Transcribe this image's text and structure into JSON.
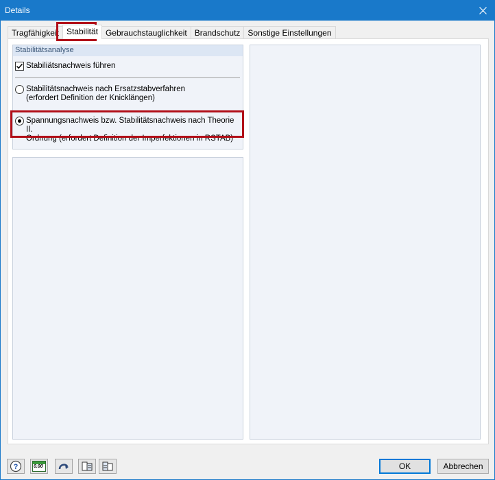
{
  "window": {
    "title": "Details"
  },
  "tabs": [
    {
      "label": "Tragfähigkeit"
    },
    {
      "label": "Stabilität"
    },
    {
      "label": "Gebrauchstauglichkeit"
    },
    {
      "label": "Brandschutz"
    },
    {
      "label": "Sonstige Einstellungen"
    }
  ],
  "stability": {
    "section_title": "Stabilitätsanalyse",
    "perform_check_label": "Stabiliätsnachweis führen",
    "option1_line1": "Stabilitätsnachweis nach Ersatzstabverfahren",
    "option1_line2": "(erfordert Definition der Knicklängen)",
    "option2_line1": "Spannungsnachweis bzw. Stabilitätsnachweis nach Theorie II.",
    "option2_line2": "Ordnung (erfordert Definition der Imperfektionen in RSTAB)"
  },
  "buttons": {
    "ok": "OK",
    "cancel": "Abbrechen"
  },
  "toolbar": {
    "units_label": "0.00"
  },
  "colors": {
    "titlebar": "#1979ca",
    "highlight": "#b10e18",
    "accent": "#0078d7"
  }
}
